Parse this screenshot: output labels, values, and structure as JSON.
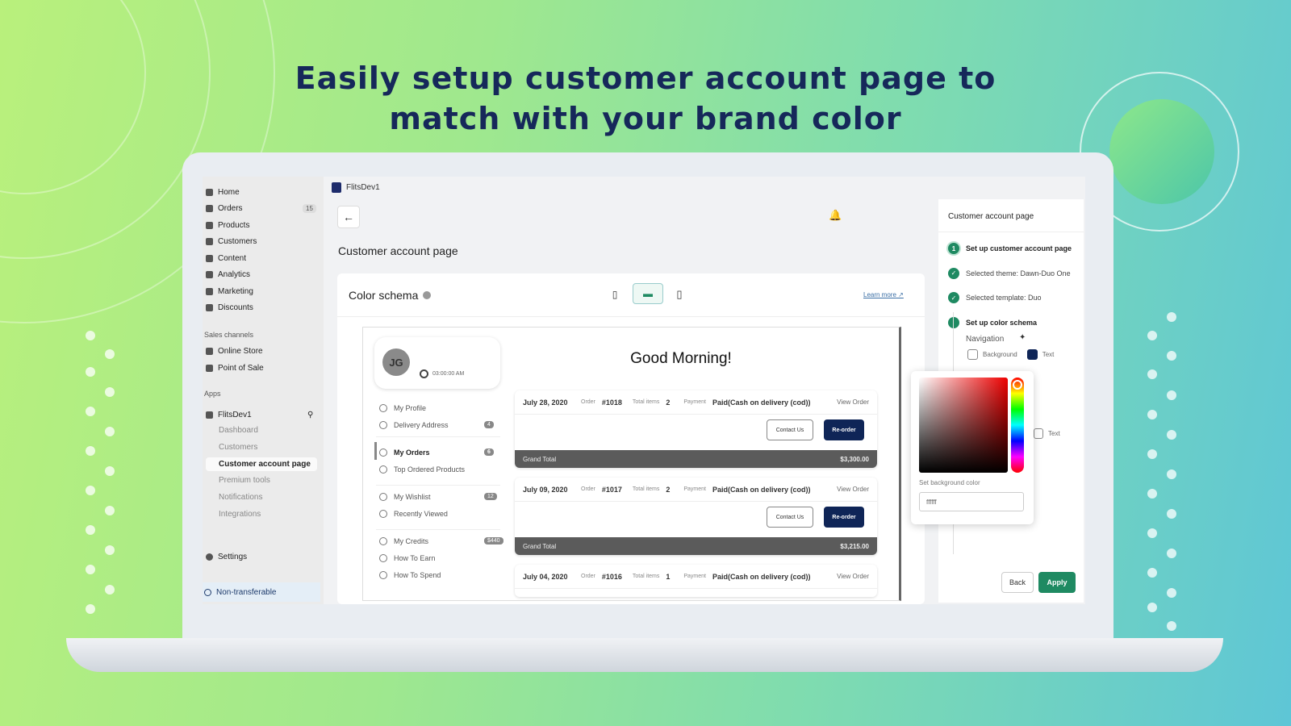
{
  "headline": {
    "line1": "Easily setup customer account page to",
    "line2": "match with your brand color"
  },
  "sidebar": {
    "items": [
      {
        "label": "Home",
        "icon": "home-icon"
      },
      {
        "label": "Orders",
        "icon": "orders-icon",
        "badge": "15"
      },
      {
        "label": "Products",
        "icon": "tag-icon"
      },
      {
        "label": "Customers",
        "icon": "person-icon"
      },
      {
        "label": "Content",
        "icon": "content-icon"
      },
      {
        "label": "Analytics",
        "icon": "chart-icon"
      },
      {
        "label": "Marketing",
        "icon": "marketing-icon"
      },
      {
        "label": "Discounts",
        "icon": "discount-icon"
      }
    ],
    "sales_channels": {
      "heading": "Sales channels",
      "items": [
        "Online Store",
        "Point of Sale"
      ]
    },
    "apps": {
      "heading": "Apps",
      "app": "FlitsDev1",
      "sub": [
        "Dashboard",
        "Customers",
        "Customer account page",
        "Premium tools",
        "Notifications",
        "Integrations"
      ],
      "active": "Customer account page"
    },
    "settings": "Settings",
    "footer": "Non-transferable"
  },
  "topbar": {
    "app_name": "FlitsDev1"
  },
  "main": {
    "page_title": "Customer account page",
    "card_title": "Color schema",
    "learn_more": "Learn more",
    "devices": [
      "mobile",
      "desktop",
      "tablet"
    ],
    "selected_device": "desktop"
  },
  "preview": {
    "initials": "JG",
    "time": "03:00:00 AM",
    "greeting": "Good Morning!",
    "nav": [
      {
        "label": "My Profile"
      },
      {
        "label": "Delivery Address",
        "badge": "4"
      },
      {
        "label": "My Orders",
        "badge": "6",
        "active": true
      },
      {
        "label": "Top Ordered Products"
      },
      {
        "label": "My Wishlist",
        "badge": "12"
      },
      {
        "label": "Recently Viewed"
      },
      {
        "label": "My Credits",
        "badge": "$440"
      },
      {
        "label": "How To Earn"
      },
      {
        "label": "How To Spend"
      }
    ],
    "labels": {
      "order": "Order",
      "total_items": "Total items",
      "payment": "Payment",
      "view_order": "View Order",
      "contact": "Contact Us",
      "reorder": "Re-order",
      "grand_total": "Grand Total"
    },
    "orders": [
      {
        "date": "July 28, 2020",
        "number": "#1018",
        "items": "2",
        "payment": "Paid(Cash on delivery (cod))",
        "total": "$3,300.00"
      },
      {
        "date": "July 09, 2020",
        "number": "#1017",
        "items": "2",
        "payment": "Paid(Cash on delivery (cod))",
        "total": "$3,215.00"
      },
      {
        "date": "July 04, 2020",
        "number": "#1016",
        "items": "1",
        "payment": "Paid(Cash on delivery (cod))"
      }
    ]
  },
  "panel": {
    "title": "Customer account page",
    "steps": [
      "Set up customer account page",
      "Selected theme: Dawn-Duo One",
      "Selected template: Duo",
      "Set up color schema"
    ],
    "navigation": "Navigation",
    "background": "Background",
    "text": "Text",
    "text2": "Text",
    "picker_label": "Set background color",
    "picker_value": "ffffff",
    "back": "Back",
    "apply": "Apply"
  },
  "colors": {
    "accent": "#1f8a62",
    "brand_navy": "#0f2557",
    "title": "#16285a"
  }
}
